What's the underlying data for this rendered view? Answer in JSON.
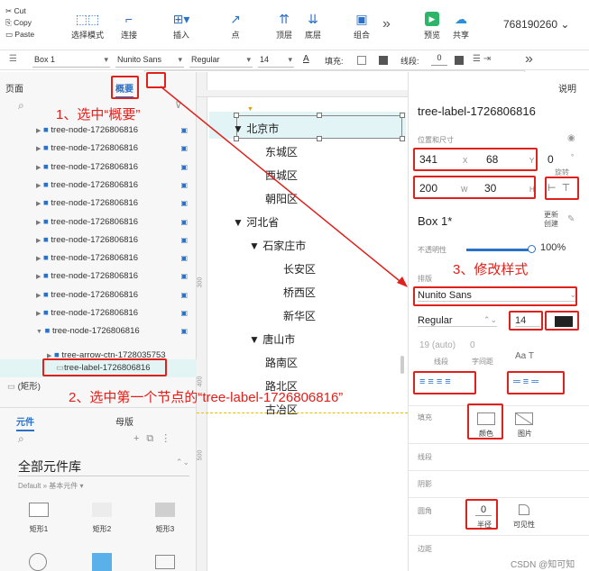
{
  "clipboard": {
    "cut": "Cut",
    "copy": "Copy",
    "paste": "Paste"
  },
  "toolbar": {
    "select_mode": "选择模式",
    "connect": "连接",
    "insert": "插入",
    "point": "点",
    "top": "顶层",
    "bottom": "底层",
    "group": "组合",
    "more": "»",
    "preview": "预览",
    "share": "共享",
    "user_id": "768190260"
  },
  "format": {
    "object": "Box 1",
    "font": "Nunito Sans",
    "style": "Regular",
    "size": "14",
    "fill_label": "填充:",
    "line_label": "线段:",
    "line_value": "0",
    "bold": "B",
    "italic": "I",
    "underline": "U",
    "more": "»"
  },
  "props": {
    "x": "341",
    "x_label": "X",
    "y": "68",
    "y_label": "Y",
    "w": "200",
    "w_label": "W",
    "h": "30",
    "h_label": "H"
  },
  "left": {
    "pages_tab": "页面",
    "outline_tab": "概要",
    "nodes": [
      "tree-node-1726806816",
      "tree-node-1726806816",
      "tree-node-1726806816",
      "tree-node-1726806816",
      "tree-node-1726806816",
      "tree-node-1726806816",
      "tree-node-1726806816",
      "tree-node-1726806816",
      "tree-node-1726806816",
      "tree-node-1726806816",
      "tree-node-1726806816",
      "tree-node-1726806816"
    ],
    "arrow_ctn": "tree-arrow-ctn-1728035753",
    "label_node": "tree-label-1726806816",
    "rect": "(矩形)",
    "widgets_tab": "元件",
    "masters_tab": "母版",
    "library": "全部元件库",
    "default_lib": "Default » 基本元件 ▾",
    "shapes": [
      "矩形1",
      "矩形2",
      "矩形3"
    ]
  },
  "canvas": {
    "ruler": [
      "300",
      "350",
      "400",
      "450",
      "500"
    ],
    "tree": [
      "北京市",
      "东城区",
      "西城区",
      "朝阳区",
      "河北省",
      "石家庄市",
      "长安区",
      "桥西区",
      "新华区",
      "唐山市",
      "路南区",
      "路北区",
      "古冶区"
    ]
  },
  "right": {
    "notes_tab": "说明",
    "title": "tree-label-1726806816",
    "pos_size": "位置和尺寸",
    "x": "341",
    "y": "68",
    "rot": "0",
    "rot_label": "旋转",
    "rot_unit": "°",
    "w": "200",
    "h": "30",
    "box": "Box 1*",
    "update": "更新",
    "create": "创建",
    "opacity_label": "不透明性",
    "opacity": "100%",
    "typography": "排版",
    "font": "Nunito Sans",
    "style": "Regular",
    "size": "14",
    "line_h": "19 (auto)",
    "line_h_label": "线段",
    "spacing": "0",
    "spacing_label": "字间距",
    "fill": "填充",
    "fill_color": "颜色",
    "fill_image": "图片",
    "border": "线段",
    "shadow": "阴影",
    "radius": "圆角",
    "radius_val": "0",
    "radius_label": "半径",
    "visibility": "可见性",
    "padding": "边距"
  },
  "annotations": {
    "step1": "1、选中“概要”",
    "step2": "2、选中第一个节点的“tree-label-1726806816”",
    "step3": "3、修改样式"
  },
  "watermark": "CSDN @知可知",
  "colors": {
    "accent": "#2a72c8",
    "annotation": "#e0201b",
    "text_color_swatch": "#222222"
  }
}
